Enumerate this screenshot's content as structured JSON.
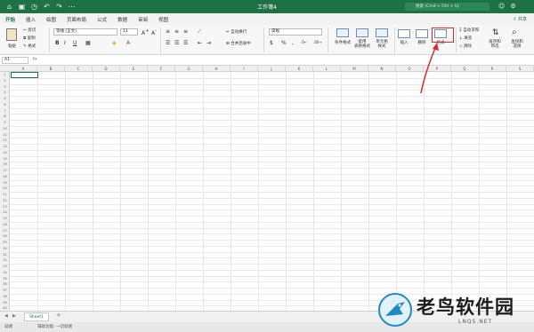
{
  "titlebar": {
    "title": "工作簿4",
    "search_placeholder": "搜索 (Cmd + Ctrl + U)"
  },
  "tabs": [
    "开始",
    "插入",
    "绘图",
    "页面布局",
    "公式",
    "数据",
    "审阅",
    "视图"
  ],
  "share_label": "共享",
  "ribbon": {
    "paste": "粘贴",
    "cut": "剪切",
    "copy": "复制",
    "format_painter": "格式",
    "font_name": "等线 (正文)",
    "font_size": "11",
    "wrap_text": "自动换行",
    "merge_center": "合并后居中",
    "number_format": "常规",
    "conditional_format": "条件格式",
    "format_as_table": "套用\n表格格式",
    "cell_styles": "单元格\n样式",
    "insert": "插入",
    "delete": "删除",
    "format": "格式",
    "autosum": "自动求和",
    "fill": "填充",
    "clear": "清除",
    "sort_filter": "排序和\n筛选",
    "find_select": "查找和\n选择"
  },
  "formula_bar": {
    "name_box": "A1",
    "fx": "fx"
  },
  "grid": {
    "columns": [
      "A",
      "B",
      "C",
      "D",
      "E",
      "F",
      "G",
      "H",
      "I",
      "J",
      "K",
      "L",
      "M",
      "N",
      "O",
      "P",
      "Q",
      "R",
      "S"
    ],
    "rows": 40
  },
  "sheets": [
    "Sheet1"
  ],
  "add_sheet": "+",
  "statusbar": {
    "ready": "就绪",
    "accessibility": "辅助功能: 一切就绪"
  },
  "watermark": {
    "text": "老鸟软件园",
    "url": "LNQS.NET"
  },
  "colors": {
    "accent": "#1e7145",
    "highlight": "#d62b2b"
  }
}
